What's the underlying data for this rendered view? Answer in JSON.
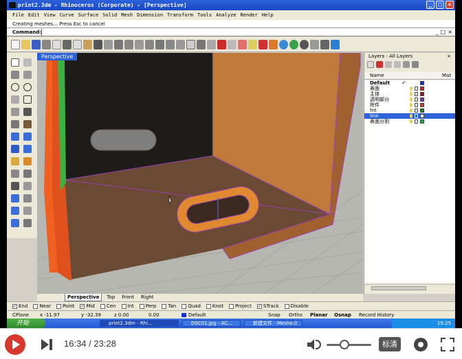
{
  "window": {
    "title": "print2.3dm - Rhinoceros (Corporate) - [Perspective]",
    "buttons": [
      "_",
      "□",
      "×"
    ]
  },
  "menu": [
    "File",
    "Edit",
    "View",
    "Curve",
    "Surface",
    "Solid",
    "Mesh",
    "Dimension",
    "Transform",
    "Tools",
    "Analyze",
    "Render",
    "Help"
  ],
  "command": {
    "history": "Creating meshes... Press Esc to cancel",
    "prompt": "Command:",
    "mini_buttons": [
      "_",
      "□",
      "×"
    ]
  },
  "viewport": {
    "label": "Perspective",
    "tabs": [
      "Perspective",
      "Top",
      "Front",
      "Right"
    ]
  },
  "layers": {
    "title": "Layers - All Layers",
    "close": "×",
    "col_name": "Name",
    "col_material": "Mat",
    "rows": [
      {
        "name": "Default",
        "check": "✓",
        "color": "#1b2fd0",
        "bold": true
      },
      {
        "name": "表面",
        "color": "#d0212b"
      },
      {
        "name": "主体",
        "color": "#8a1a24"
      },
      {
        "name": "透明部分",
        "color": "#7a2fa8"
      },
      {
        "name": "附件",
        "color": "#c43a3a"
      },
      {
        "name": "fnt",
        "color": "#1a7f2a"
      },
      {
        "name": "line",
        "color": "#ffffff",
        "selected": true
      },
      {
        "name": "表面分割",
        "color": "#1fb03a"
      }
    ]
  },
  "osnap": [
    {
      "label": "End",
      "checked": true
    },
    {
      "label": "Near",
      "checked": false
    },
    {
      "label": "Point",
      "checked": false
    },
    {
      "label": "Mid",
      "checked": true
    },
    {
      "label": "Cen",
      "checked": false
    },
    {
      "label": "Int",
      "checked": false
    },
    {
      "label": "Perp",
      "checked": false
    },
    {
      "label": "Tan",
      "checked": false
    },
    {
      "label": "Quad",
      "checked": false
    },
    {
      "label": "Knot",
      "checked": false
    },
    {
      "label": "Project",
      "checked": false
    },
    {
      "label": "STrack",
      "checked": true
    },
    {
      "label": "Disable",
      "checked": false
    }
  ],
  "status": {
    "cplane": "CPlane",
    "x": "x -11.97",
    "y": "y -32.39",
    "z": "z 0.00",
    "extra": "0.00",
    "layer": "Default",
    "snap": "Snap",
    "ortho": "Ortho",
    "planar": "Planar",
    "osnap": "Osnap",
    "record": "Record History"
  },
  "taskbar": {
    "start": "开始",
    "tasks": [
      "print2.3dm - Rhi...",
      "DSC01.jpg - AC...",
      "新建文件 - Meshe.0"
    ],
    "clock": "19:25"
  },
  "player": {
    "current": "16:34",
    "total": "23:28",
    "separator": "/",
    "quality": "标清",
    "volume": 0.3
  }
}
